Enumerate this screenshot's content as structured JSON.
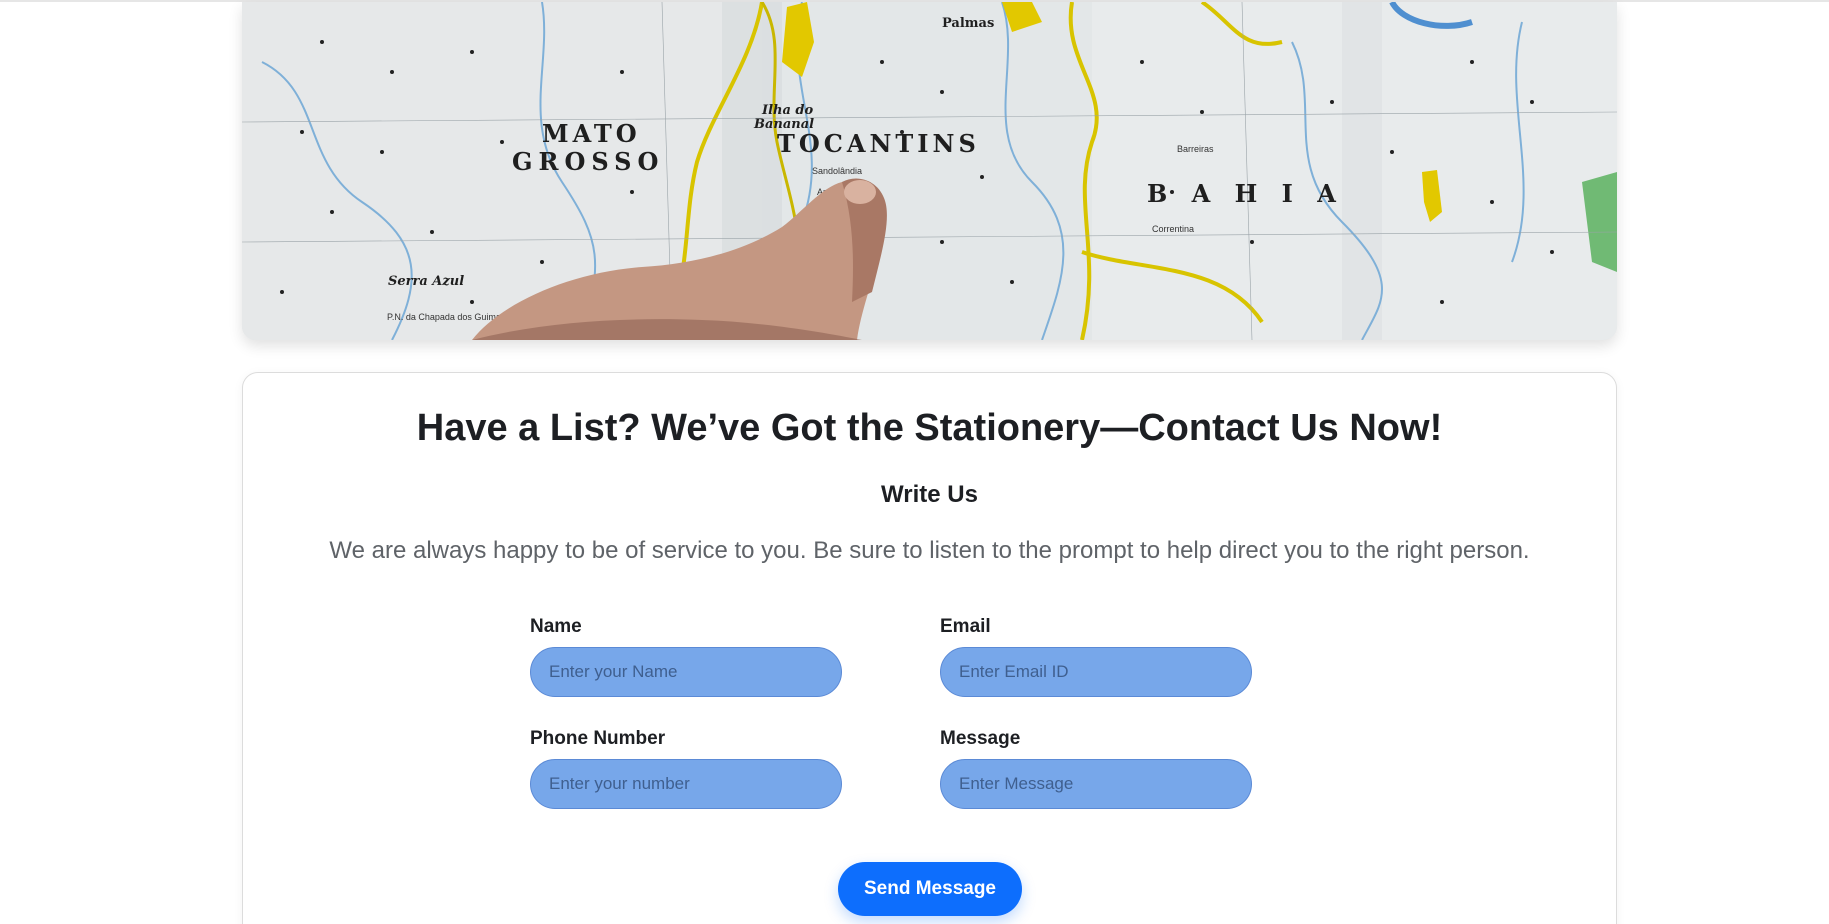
{
  "banner": {
    "map_labels": {
      "mato": "MATO",
      "grosso": "GROSSO",
      "tocantins": "TOCANTINS",
      "bahia": "B A H I A",
      "ilha_do": "Ilha do",
      "bananal": "Bananal",
      "palmas": "Palmas",
      "serra_azul": "Serra Azul",
      "sandolandia": "Sandolândia",
      "barreiras": "Barreiras",
      "araguaina": "Araguaçu",
      "correntina": "Correntina",
      "pn_chapada": "P.N. da Chapada dos Guimarães"
    }
  },
  "contact": {
    "title": "Have a List? We’ve Got the Stationery—Contact Us Now!",
    "subtitle": "Write Us",
    "description": "We are always happy to be of service to you. Be sure to listen to the prompt to help direct you to the right person.",
    "fields": {
      "name": {
        "label": "Name",
        "placeholder": "Enter your Name",
        "value": ""
      },
      "email": {
        "label": "Email",
        "placeholder": "Enter Email ID",
        "value": ""
      },
      "phone": {
        "label": "Phone Number",
        "placeholder": "Enter your number",
        "value": ""
      },
      "message": {
        "label": "Message",
        "placeholder": "Enter Message",
        "value": ""
      }
    },
    "submit_label": "Send Message"
  },
  "colors": {
    "accent": "#0d6efd",
    "input_fill": "#77a7ea",
    "title_text": "#1d1f23",
    "muted_text": "#5f6368"
  }
}
